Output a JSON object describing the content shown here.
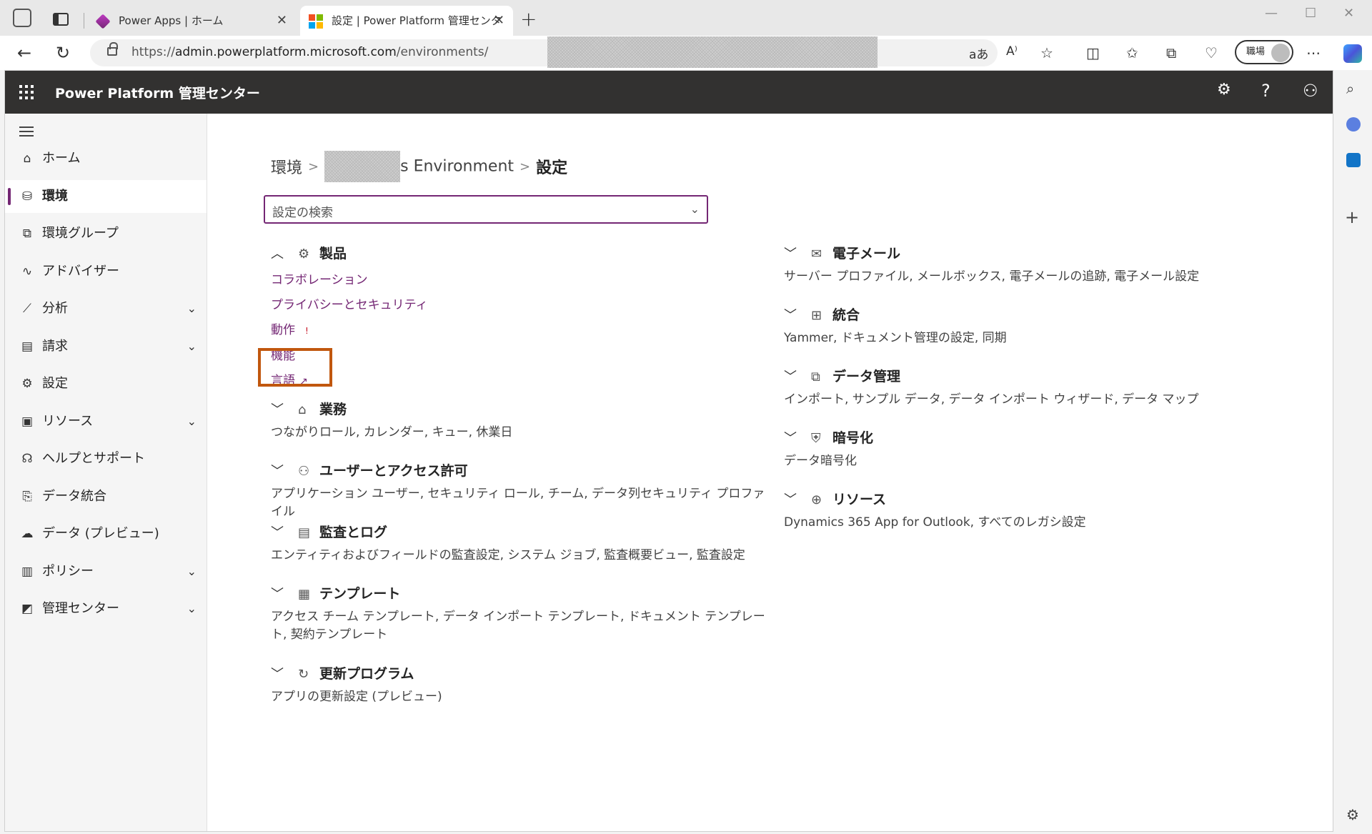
{
  "browser": {
    "tabs": [
      {
        "title": "Power Apps | ホーム",
        "active": false
      },
      {
        "title": "設定 | Power Platform 管理センタ",
        "active": true
      }
    ],
    "new_tab": "+",
    "url": {
      "prefix": "https://",
      "host": "admin.powerplatform.microsoft.com",
      "path": "/environments/"
    },
    "profile_label": "職場"
  },
  "app": {
    "title": "Power Platform 管理センター"
  },
  "nav": {
    "items": [
      {
        "label": "ホーム",
        "icon": "home-icon",
        "glyph": "⌂",
        "chevron": false,
        "selected": false
      },
      {
        "label": "環境",
        "icon": "environment-icon",
        "glyph": "⛁",
        "chevron": false,
        "selected": true
      },
      {
        "label": "環境グループ",
        "icon": "environment-group-icon",
        "glyph": "⧉",
        "chevron": false,
        "selected": false
      },
      {
        "label": "アドバイザー",
        "icon": "pulse-icon",
        "glyph": "∿",
        "chevron": false,
        "selected": false
      },
      {
        "label": "分析",
        "icon": "chart-icon",
        "glyph": "⟋",
        "chevron": true,
        "selected": false
      },
      {
        "label": "請求",
        "icon": "billing-icon",
        "glyph": "▤",
        "chevron": true,
        "selected": false
      },
      {
        "label": "設定",
        "icon": "gear-icon",
        "glyph": "⚙",
        "chevron": false,
        "selected": false
      },
      {
        "label": "リソース",
        "icon": "resources-icon",
        "glyph": "▣",
        "chevron": true,
        "selected": false
      },
      {
        "label": "ヘルプとサポート",
        "icon": "headset-icon",
        "glyph": "☊",
        "chevron": false,
        "selected": false
      },
      {
        "label": "データ統合",
        "icon": "data-integration-icon",
        "glyph": "⎘",
        "chevron": false,
        "selected": false
      },
      {
        "label": "データ (プレビュー)",
        "icon": "cloud-data-icon",
        "glyph": "☁",
        "chevron": false,
        "selected": false
      },
      {
        "label": "ポリシー",
        "icon": "policy-icon",
        "glyph": "▥",
        "chevron": true,
        "selected": false
      },
      {
        "label": "管理センター",
        "icon": "admin-center-icon",
        "glyph": "◩",
        "chevron": true,
        "selected": false
      }
    ]
  },
  "breadcrumb": {
    "root": "環境",
    "env_suffix": "s Environment",
    "current": "設定"
  },
  "search": {
    "placeholder": "設定の検索"
  },
  "sections_left": [
    {
      "title": "製品",
      "icon": "gear-icon",
      "glyph": "⚙",
      "expanded": true,
      "links": [
        {
          "label": "コラボレーション",
          "warn": false,
          "ext": false
        },
        {
          "label": "プライバシーとセキュリティ",
          "warn": false,
          "ext": false
        },
        {
          "label": "動作",
          "warn": true,
          "ext": false
        },
        {
          "label": "機能",
          "warn": false,
          "ext": false
        },
        {
          "label": "言語",
          "warn": false,
          "ext": true
        }
      ]
    },
    {
      "title": "業務",
      "icon": "business-icon",
      "glyph": "⌂",
      "desc": "つながりロール, カレンダー, キュー, 休業日"
    },
    {
      "title": "ユーザーとアクセス許可",
      "icon": "users-icon",
      "glyph": "⚇",
      "desc": "アプリケーション ユーザー, セキュリティ ロール, チーム, データ列セキュリティ プロファイル"
    },
    {
      "title": "監査とログ",
      "icon": "audit-icon",
      "glyph": "▤",
      "desc": "エンティティおよびフィールドの監査設定, システム ジョブ, 監査概要ビュー, 監査設定"
    },
    {
      "title": "テンプレート",
      "icon": "template-icon",
      "glyph": "▦",
      "desc": "アクセス チーム テンプレート, データ インポート テンプレート, ドキュメント テンプレート, 契約テンプレート"
    },
    {
      "title": "更新プログラム",
      "icon": "refresh-icon",
      "glyph": "↻",
      "desc": "アプリの更新設定 (プレビュー)"
    }
  ],
  "sections_right": [
    {
      "title": "電子メール",
      "icon": "mail-icon",
      "glyph": "✉",
      "desc": "サーバー プロファイル, メールボックス, 電子メールの追跡, 電子メール設定"
    },
    {
      "title": "統合",
      "icon": "windows-icon",
      "glyph": "⊞",
      "desc": "Yammer, ドキュメント管理の設定, 同期"
    },
    {
      "title": "データ管理",
      "icon": "data-management-icon",
      "glyph": "⧉",
      "desc": "インポート, サンプル データ, データ インポート ウィザード, データ マップ"
    },
    {
      "title": "暗号化",
      "icon": "shield-icon",
      "glyph": "⛨",
      "desc": "データ暗号化"
    },
    {
      "title": "リソース",
      "icon": "globe-icon",
      "glyph": "⊕",
      "desc": "Dynamics 365 App for Outlook, すべてのレガシ設定"
    }
  ],
  "colors": {
    "accent": "#742774",
    "highlight": "#c1570e",
    "appbar": "#323130"
  }
}
